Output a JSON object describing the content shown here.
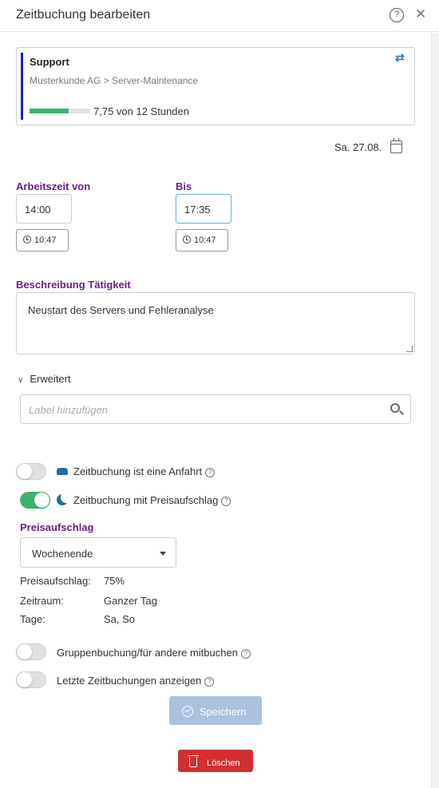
{
  "header": {
    "title": "Zeitbuchung bearbeiten",
    "help_icon": "?",
    "close_icon": "✕"
  },
  "project": {
    "title": "Support",
    "breadcrumb": "Musterkunde AG > Server-Maintenance",
    "swap_icon": "⇄",
    "progress_fraction": 0.646,
    "hours_text": "7,75 von 12 Stunden",
    "accent_color": "#1a1fd0",
    "progress_color": "#3bb36d"
  },
  "date": {
    "value": "Sa. 27.08."
  },
  "worktime": {
    "from_label": "Arbeitszeit von",
    "from_value": "14:00",
    "from_now": "10:47",
    "to_label": "Bis",
    "to_value": "17:35",
    "to_now": "10:47"
  },
  "description": {
    "label": "Beschreibung Tätigkeit",
    "value": "Neustart des Servers und Fehleranalyse"
  },
  "extended": {
    "label": "Erweitert",
    "label_placeholder": "Label hinzufügen"
  },
  "toggles": {
    "travel": {
      "label": "Zeitbuchung ist eine Anfahrt",
      "on": false
    },
    "surcharge": {
      "label": "Zeitbuchung mit Preisaufschlag",
      "on": true
    },
    "group": {
      "label": "Gruppenbuchung/für andere mitbuchen",
      "on": false
    },
    "recent": {
      "label": "Letzte Zeitbuchungen anzeigen",
      "on": false
    }
  },
  "surcharge": {
    "label": "Preisaufschlag",
    "selected": "Wochenende",
    "rows": [
      {
        "key": "Preisaufschlag:",
        "value": "75%"
      },
      {
        "key": "Zeitraum:",
        "value": "Ganzer Tag"
      },
      {
        "key": "Tage:",
        "value": "Sa, So"
      }
    ]
  },
  "actions": {
    "save_label": "Speichern",
    "delete_label": "Löschen"
  }
}
